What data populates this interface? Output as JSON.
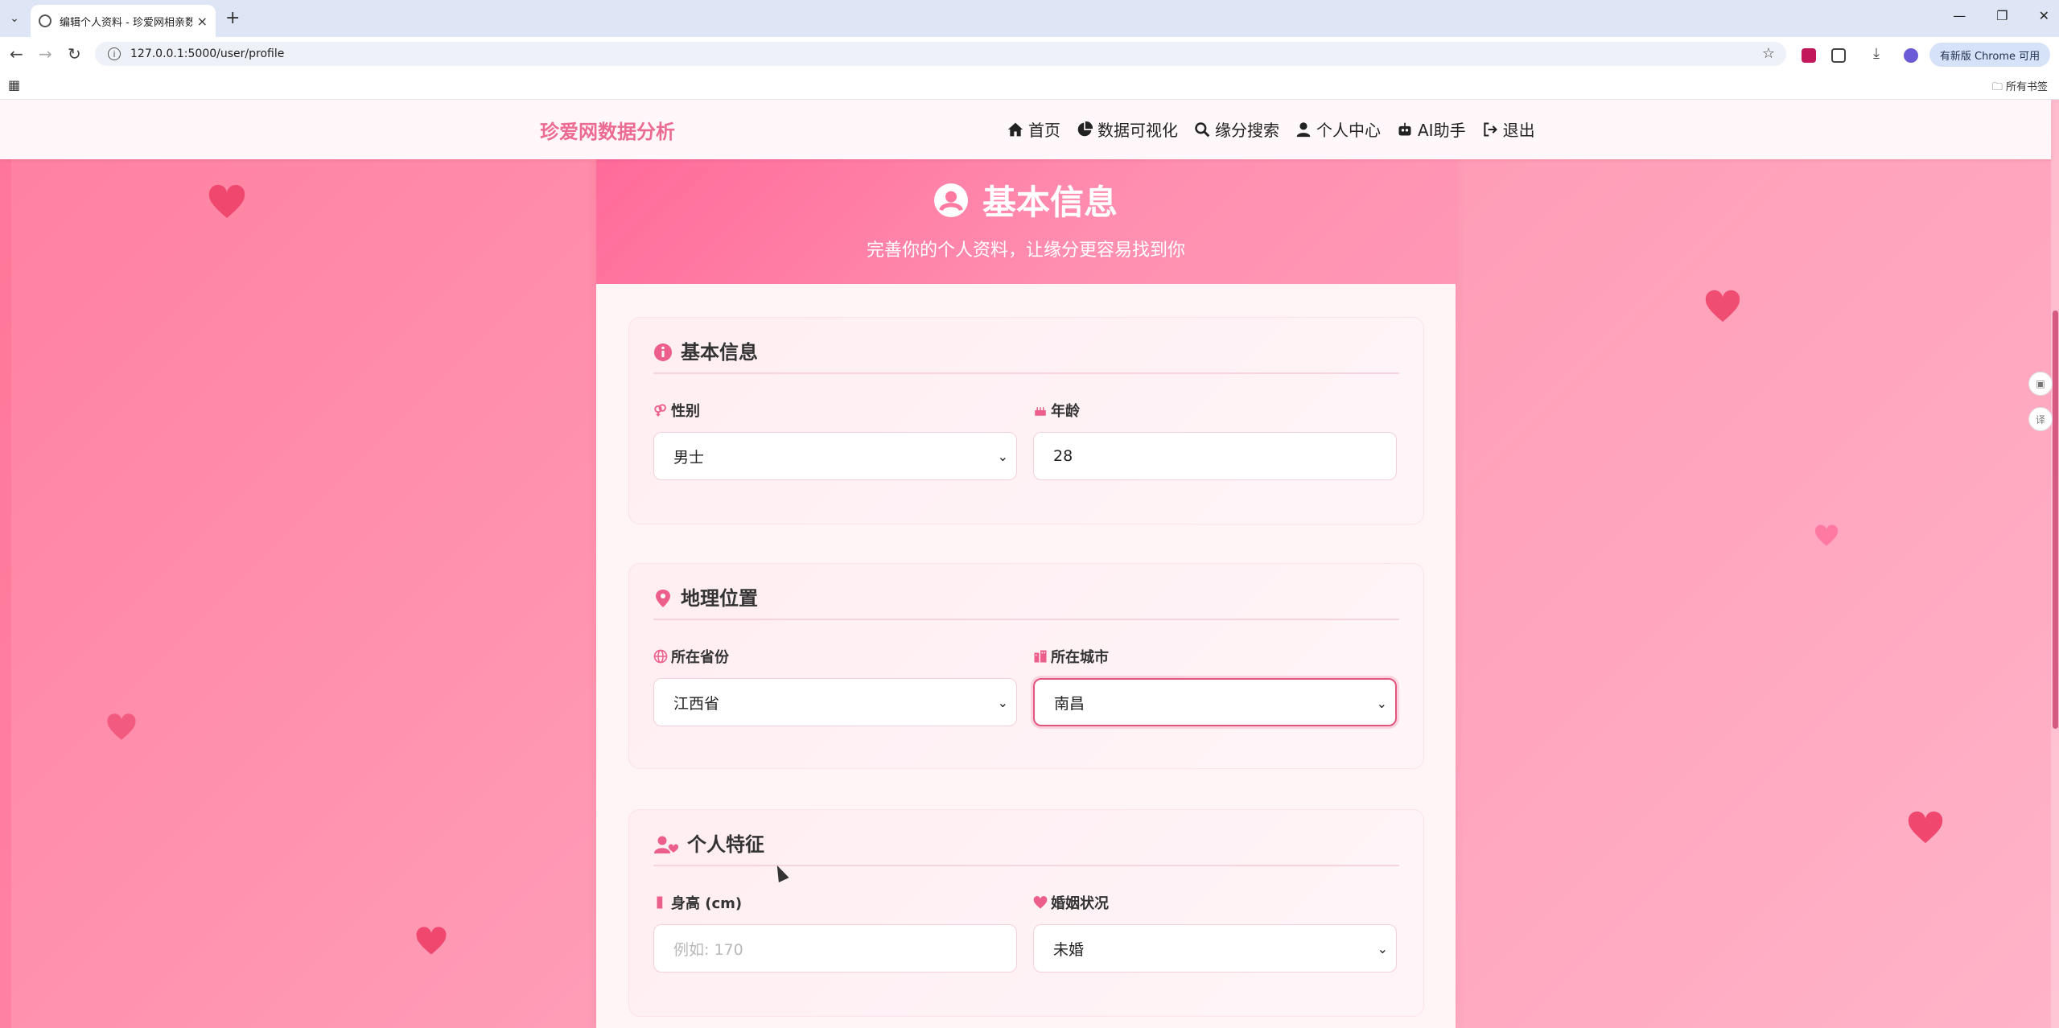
{
  "browser": {
    "tab_title": "编辑个人资料 - 珍爱网相亲数据",
    "url": "127.0.0.1:5000/user/profile",
    "update_label": "有新版 Chrome 可用",
    "all_bookmarks": "所有书签"
  },
  "navbar": {
    "brand": "珍爱网数据分析",
    "items": [
      {
        "label": "首页",
        "icon": "home-icon"
      },
      {
        "label": "数据可视化",
        "icon": "chart-pie-icon"
      },
      {
        "label": "缘分搜索",
        "icon": "search-icon"
      },
      {
        "label": "个人中心",
        "icon": "user-icon"
      },
      {
        "label": "AI助手",
        "icon": "robot-icon"
      },
      {
        "label": "退出",
        "icon": "logout-icon"
      }
    ]
  },
  "hero": {
    "title": "基本信息",
    "subtitle": "完善你的个人资料，让缘分更容易找到你"
  },
  "sections": {
    "basic": {
      "title": "基本信息",
      "gender": {
        "label": "性别",
        "value": "男士"
      },
      "age": {
        "label": "年龄",
        "value": "28"
      }
    },
    "location": {
      "title": "地理位置",
      "province": {
        "label": "所在省份",
        "value": "江西省"
      },
      "city": {
        "label": "所在城市",
        "value": "南昌"
      }
    },
    "traits": {
      "title": "个人特征",
      "height": {
        "label": "身高 (cm)",
        "placeholder": "例如: 170"
      },
      "marital": {
        "label": "婚姻状况",
        "value": "未婚"
      }
    }
  },
  "colors": {
    "accent": "#ec6b93",
    "hero_gradient_start": "#ff6b9a",
    "page_bg": "#ff9cb6"
  }
}
